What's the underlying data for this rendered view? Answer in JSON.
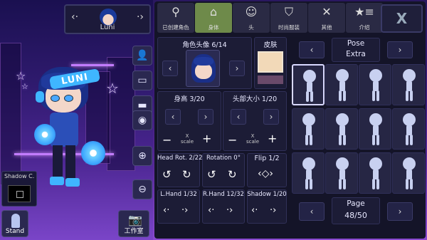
{
  "name_selector": {
    "character_name": "Luni"
  },
  "stage": {
    "character_tag": "LUNI",
    "shadow_label": "Shadow C.",
    "stand_label": "Stand",
    "studio_label": "工作室"
  },
  "tabs": [
    {
      "label": "已创建角色",
      "icon": "person-silhouette-icon"
    },
    {
      "label": "身体",
      "icon": "jacket-icon",
      "active": true
    },
    {
      "label": "头",
      "icon": "hair-icon"
    },
    {
      "label": "时尚服装",
      "icon": "shirt-icon"
    },
    {
      "label": "其他",
      "icon": "cat-sword-icon"
    },
    {
      "label": "介绍",
      "icon": "star-list-icon"
    }
  ],
  "close_label": "X",
  "avatar_section": {
    "label": "角色头像 6/14"
  },
  "skin_section": {
    "label": "皮肤",
    "skin_color": "#f2d9b8"
  },
  "height": {
    "label": "身高 3/20"
  },
  "head_size": {
    "label": "头部大小 1/20"
  },
  "scale_x": {
    "x": "X",
    "scale": "scale"
  },
  "head_rot": {
    "label": "Head Rot. 2/22"
  },
  "rotation": {
    "label": "Rotation 0°"
  },
  "flip": {
    "label": "Flip 1/2"
  },
  "lhand": {
    "label": "L.Hand 1/32"
  },
  "rhand": {
    "label": "R.Hand 12/32"
  },
  "shadow": {
    "label": "Shadow 1/20"
  },
  "pose_header": {
    "line1": "Pose",
    "line2": "Extra"
  },
  "page": {
    "label": "Page",
    "value": "48/50"
  },
  "colors": {
    "accent": "#6e8a4a",
    "panel": "#141428"
  }
}
